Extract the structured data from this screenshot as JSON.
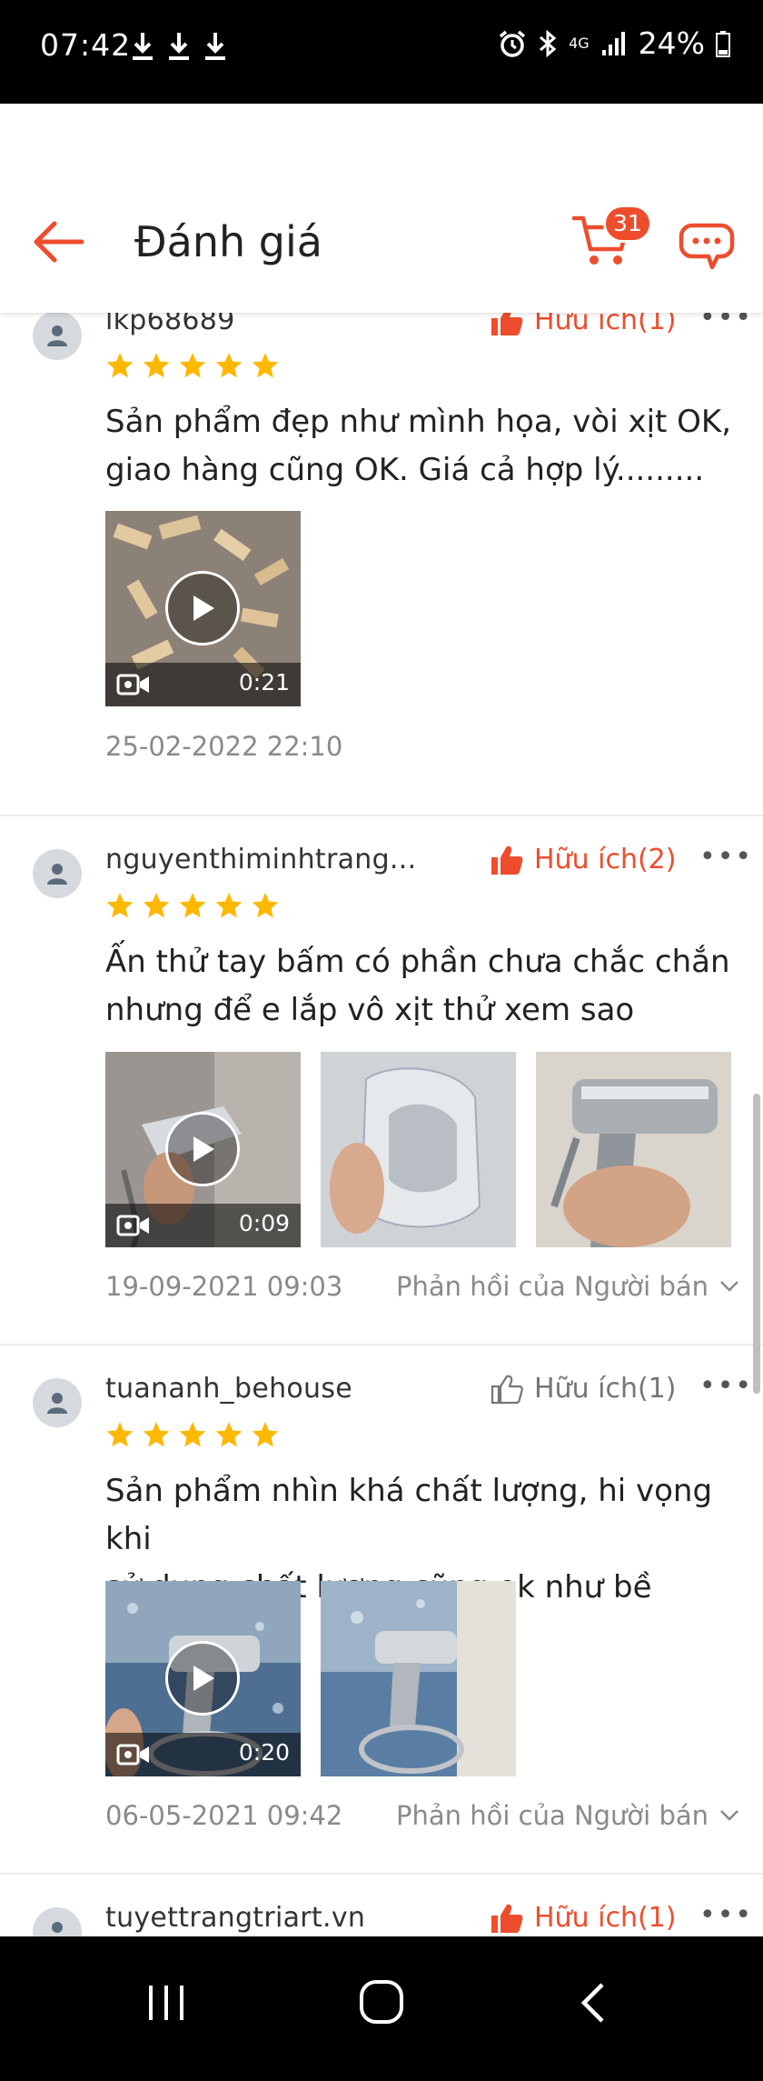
{
  "status_bar": {
    "time": "07:42",
    "network": "4G",
    "battery": "24%"
  },
  "header": {
    "title": "Đánh giá",
    "cart_count": "31"
  },
  "colors": {
    "accent": "#ee4d2d",
    "star": "#ffb800",
    "text_muted": "#8a8a8a"
  },
  "reviews": [
    {
      "username": "lkp68689",
      "helpful_label": "Hữu ích(1)",
      "helpful_active": true,
      "rating": 5,
      "text_lines": [
        "Sản phẩm đẹp như mình họa, vòi xịt OK,",
        "giao hàng cũng OK. Giá cả hợp lý........."
      ],
      "media": [
        {
          "type": "video",
          "duration": "0:21"
        }
      ],
      "date": "25-02-2022 22:10",
      "seller_reply": ""
    },
    {
      "username": "nguyenthiminhtrang...",
      "helpful_label": "Hữu ích(2)",
      "helpful_active": true,
      "rating": 5,
      "text_lines": [
        "Ấn thử tay bấm có phần chưa chắc chắn",
        "nhưng để e lắp vô xịt thử xem sao"
      ],
      "media": [
        {
          "type": "video",
          "duration": "0:09"
        },
        {
          "type": "image"
        },
        {
          "type": "image"
        }
      ],
      "date": "19-09-2021 09:03",
      "seller_reply": "Phản hồi của Người bán"
    },
    {
      "username": "tuananh_behouse",
      "helpful_label": "Hữu ích(1)",
      "helpful_active": false,
      "rating": 5,
      "text_lines": [
        "Sản phẩm nhìn khá chất lượng, hi vọng khi",
        "sử dụng chất lượng cũng ok như bề ngoài."
      ],
      "media": [
        {
          "type": "video",
          "duration": "0:20"
        },
        {
          "type": "image"
        }
      ],
      "date": "06-05-2021 09:42",
      "seller_reply": "Phản hồi của Người bán"
    },
    {
      "username": "tuyettrangtriart.vn",
      "helpful_label": "Hữu ích(1)",
      "helpful_active": true,
      "rating": 5,
      "text_lines": [],
      "media": [],
      "date": "",
      "seller_reply": ""
    }
  ]
}
